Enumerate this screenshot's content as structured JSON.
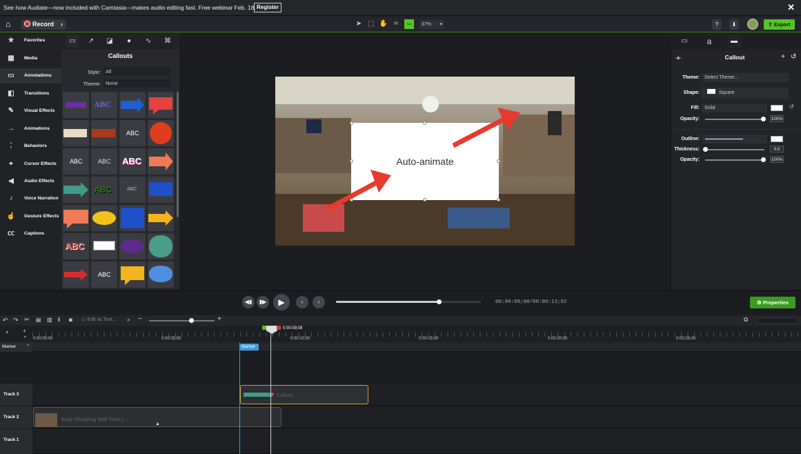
{
  "banner": {
    "message": "See how Audiate—now included with Camtasia—makes audio editing fast. Free webinar Feb. 18.",
    "register": "Register",
    "close": "✕"
  },
  "toolbar": {
    "record_label": "Record",
    "zoom": "37%",
    "help": "?",
    "export_label": "Export"
  },
  "sidebar": {
    "items": [
      {
        "label": "Favorites",
        "icon": "★"
      },
      {
        "label": "Media",
        "icon": "▦"
      },
      {
        "label": "Annotations",
        "icon": "▭"
      },
      {
        "label": "Transitions",
        "icon": "◧"
      },
      {
        "label": "Visual Effects",
        "icon": "✎"
      },
      {
        "label": "Animations",
        "icon": "→"
      },
      {
        "label": "Behaviors",
        "icon": "⁚"
      },
      {
        "label": "Cursor Effects",
        "icon": "⌖"
      },
      {
        "label": "Audio Effects",
        "icon": "◀"
      },
      {
        "label": "Voice Narration",
        "icon": "♪"
      },
      {
        "label": "Gesture Effects",
        "icon": "☝"
      },
      {
        "label": "Captions",
        "icon": "㏄"
      }
    ]
  },
  "callouts_panel": {
    "title": "Callouts",
    "style_label": "Style:",
    "style_value": "All",
    "theme_label": "Theme:",
    "theme_value": "None"
  },
  "canvas": {
    "callout_text": "Auto-animate"
  },
  "properties": {
    "title": "Callout",
    "text_tab": "a",
    "theme_label": "Theme:",
    "theme_value": "Select Theme...",
    "shape_label": "Shape:",
    "shape_value": "Square",
    "fill_label": "Fill:",
    "fill_value": "Solid",
    "opacity_label": "Opacity:",
    "opacity_value": "100%",
    "outline_label": "Outline:",
    "thickness_label": "Thickness:",
    "thickness_value": "0.0",
    "opacity2_label": "Opacity:",
    "opacity2_value": "100%"
  },
  "playback": {
    "current": "00:00:09;08",
    "total": "00:00:13;02",
    "properties_label": "Properties",
    "progress": 0.71
  },
  "timeline": {
    "edit_as_text": "Edit as Text...",
    "playhead_time": "0:00:09;08",
    "ticks": [
      "0:00:00;00",
      "0:00:05;00",
      "0:00:10;00",
      "0:00:15;00",
      "0:00:20;00",
      "0:00:25;00"
    ],
    "marker_label": "Marker",
    "marker_tag": "Marker",
    "tracks": [
      {
        "label": "Track 3"
      },
      {
        "label": "Track 2"
      },
      {
        "label": "Track 1"
      }
    ],
    "clip_callout": "Callout",
    "clip_video": "Busy Shopping Mall Time L..."
  }
}
